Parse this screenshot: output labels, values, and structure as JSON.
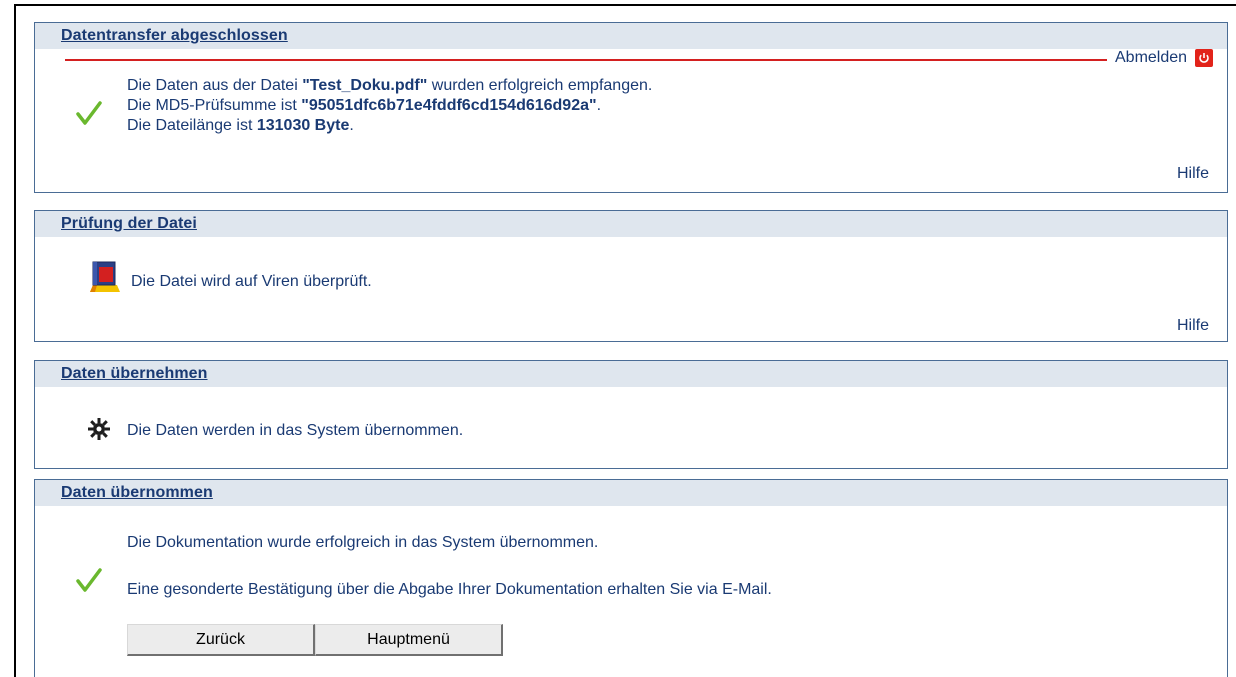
{
  "panels": {
    "transfer": {
      "title": "Datentransfer abgeschlossen",
      "logout_label": "Abmelden",
      "line1_prefix": "Die Daten aus der Datei ",
      "file_name": "\"Test_Doku.pdf\"",
      "line1_suffix": " wurden erfolgreich empfangen.",
      "line2_prefix": "Die MD5-Prüfsumme ist ",
      "md5": "\"95051dfc6b71e4fddf6cd154d616d92a\"",
      "line2_suffix": ".",
      "line3_prefix": "Die Dateilänge ist ",
      "file_size": "131030 Byte",
      "line3_suffix": ".",
      "help_label": "Hilfe"
    },
    "check": {
      "title": "Prüfung der Datei",
      "message": "Die Datei wird auf Viren überprüft.",
      "help_label": "Hilfe"
    },
    "apply": {
      "title": "Daten übernehmen",
      "message": "Die Daten werden in das System übernommen."
    },
    "done": {
      "title": "Daten übernommen",
      "message1": "Die Dokumentation wurde erfolgreich in das System übernommen.",
      "message2": "Eine gesonderte Bestätigung über die Abgabe Ihrer Dokumentation erhalten Sie via E-Mail.",
      "back_label": "Zurück",
      "main_menu_label": "Hauptmenü"
    }
  },
  "colors": {
    "text": "#1a3a73",
    "header_bg": "#dfe6ee",
    "border": "#4a6c95",
    "logout_line": "#d42020",
    "success_check": "#6ab82e"
  },
  "icons": {
    "success": "check-icon",
    "virus_scan": "virus-scanner-icon",
    "processing": "gear-icon",
    "logout": "power-icon"
  }
}
